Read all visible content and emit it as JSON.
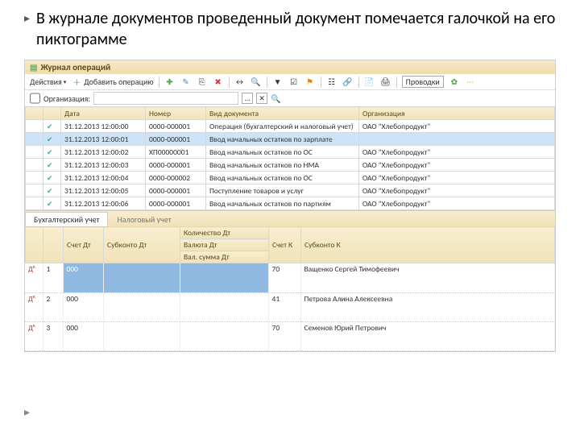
{
  "slide": {
    "bullet_text": "В журнале документов проведенный документ помечается галочкой на его пиктограмме"
  },
  "app": {
    "title": "Журнал операций"
  },
  "toolbar": {
    "actions": "Действия",
    "add_op": "Добавить операцию",
    "provodki": "Проводки"
  },
  "filter": {
    "label": "Организация:",
    "value": ""
  },
  "grid_headers": {
    "date": "Дата",
    "number": "Номер",
    "doc_type": "Вид документа",
    "org": "Организация"
  },
  "rows": [
    {
      "date": "31.12.2013 12:00:00",
      "num": "0000-000001",
      "doc": "Операция (бухгалтерский и налоговый учет)",
      "org": "ОАО \"Хлебопродукт\""
    },
    {
      "date": "31.12.2013 12:00:01",
      "num": "0000-000001",
      "doc": "Ввод начальных остатков по зарплате",
      "org": ""
    },
    {
      "date": "31.12.2013 12:00:02",
      "num": "ХП00000001",
      "doc": "Ввод начальных остатков по ОС",
      "org": "ОАО \"Хлебопродукт\""
    },
    {
      "date": "31.12.2013 12:00:03",
      "num": "0000-000001",
      "doc": "Ввод начальных остатков по НМА",
      "org": "ОАО \"Хлебопродукт\""
    },
    {
      "date": "31.12.2013 12:00:04",
      "num": "0000-000002",
      "doc": "Ввод начальных остатков по ОС",
      "org": "ОАО \"Хлебопродукт\""
    },
    {
      "date": "31.12.2013 12:00:05",
      "num": "0000-000001",
      "doc": "Поступление товаров и услуг",
      "org": "ОАО \"Хлебопродукт\""
    },
    {
      "date": "31.12.2013 12:00:06",
      "num": "0000-000001",
      "doc": "Ввод начальных остатков по партиям",
      "org": "ОАО \"Хлебопродукт\""
    }
  ],
  "tabs": {
    "acc": "Бухгалтерский учет",
    "tax": "Налоговый учет"
  },
  "lower_headers": {
    "acc_dt": "Счет Дт",
    "sub_dt": "Субконто Дт",
    "qty_dt": "Количество Дт",
    "cur_dt": "Валюта Дт",
    "sum_dt": "Вал. сумма Дт",
    "acc_kt": "Счет К",
    "sub_kt": "Субконто К"
  },
  "lower_rows": [
    {
      "n": "1",
      "dt": "000",
      "kt": "70",
      "sub": "Ващенко Сергей Тимофеевич"
    },
    {
      "n": "2",
      "dt": "000",
      "kt": "41",
      "sub": "Петрова Алина Алексеевна"
    },
    {
      "n": "3",
      "dt": "000",
      "kt": "70",
      "sub": "Семенов Юрий Петрович"
    }
  ]
}
